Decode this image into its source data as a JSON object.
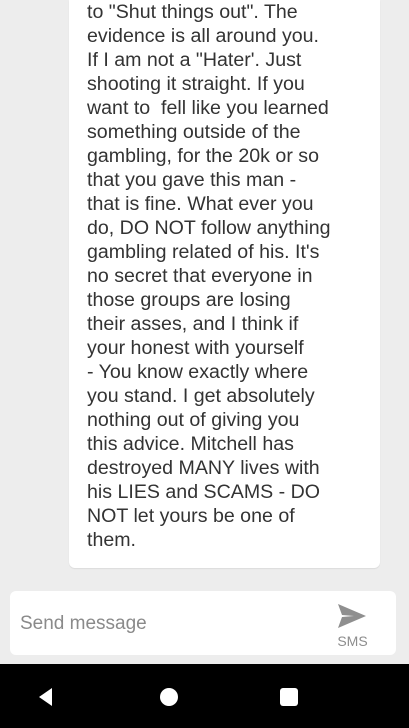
{
  "message": {
    "lines": [
      "to \"Shut things out\". The",
      "evidence is all around you.",
      "If I am not a \"Hater'. Just",
      "shooting it straight. If you",
      "want to  fell like you learned",
      "something outside of the",
      "gambling, for the 20k or so",
      "that you gave this man -",
      "that is fine. What ever you",
      "do, DO NOT follow anything",
      "gambling related of his. It's",
      "no secret that everyone in",
      "those groups are losing",
      "their asses, and I think if",
      "your honest with yourself",
      "- You know exactly where",
      "you stand. I get absolutely",
      "nothing out of giving you",
      "this advice. Mitchell has",
      "destroyed MANY lives with",
      "his LIES and SCAMS - DO",
      "NOT let yours be one of",
      "them."
    ]
  },
  "composer": {
    "placeholder": "Send message",
    "send_label": "SMS",
    "send_icon": "send-icon"
  },
  "navigation": {
    "back_icon": "back-icon",
    "home_icon": "home-icon",
    "recents_icon": "recents-icon"
  },
  "colors": {
    "background": "#ededed",
    "bubble": "#ffffff",
    "text": "#333333",
    "muted": "#8a8a8a",
    "navbar": "#000000"
  }
}
